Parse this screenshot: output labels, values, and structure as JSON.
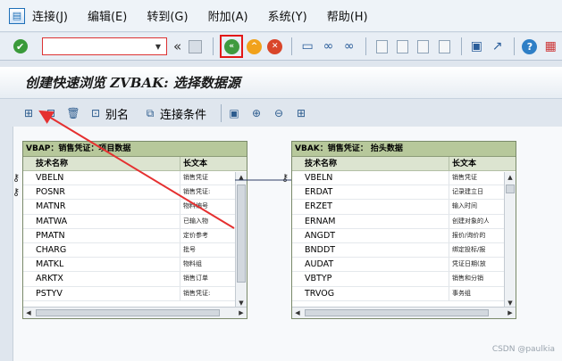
{
  "menu": [
    "连接(J)",
    "编辑(E)",
    "转到(G)",
    "附加(A)",
    "系统(Y)",
    "帮助(H)"
  ],
  "toolbar": {
    "command_value": ""
  },
  "title": "创建快速浏览 ZVBAK: 选择数据源",
  "app_toolbar": {
    "alias_label": "别名",
    "join_label": "连接条件"
  },
  "left_table": {
    "title": "VBAP：销售凭证：项目数据",
    "col_name": "技术名称",
    "col_text": "长文本",
    "rows": [
      {
        "name": "VBELN",
        "text": "销售凭证",
        "key": true
      },
      {
        "name": "POSNR",
        "text": "销售凭证:",
        "key": true
      },
      {
        "name": "MATNR",
        "text": "物料编号",
        "key": false
      },
      {
        "name": "MATWA",
        "text": "已输入物",
        "key": false
      },
      {
        "name": "PMATN",
        "text": "定价参考",
        "key": false
      },
      {
        "name": "CHARG",
        "text": "批号",
        "key": false
      },
      {
        "name": "MATKL",
        "text": "物料组",
        "key": false
      },
      {
        "name": "ARKTX",
        "text": "销售订单",
        "key": false
      },
      {
        "name": "PSTYV",
        "text": "销售凭证:",
        "key": false
      }
    ]
  },
  "right_table": {
    "title": "VBAK：销售凭证： 抬头数据",
    "col_name": "技术名称",
    "col_text": "长文本",
    "rows": [
      {
        "name": "VBELN",
        "text": "销售凭证",
        "key": true
      },
      {
        "name": "ERDAT",
        "text": "记录建立日",
        "key": false
      },
      {
        "name": "ERZET",
        "text": "输入时间",
        "key": false
      },
      {
        "name": "ERNAM",
        "text": "创建对象的人",
        "key": false
      },
      {
        "name": "ANGDT",
        "text": "报价/询价的",
        "key": false
      },
      {
        "name": "BNDDT",
        "text": "绑定投标/报",
        "key": false
      },
      {
        "name": "AUDAT",
        "text": "凭证日期(放",
        "key": false
      },
      {
        "name": "VBTYP",
        "text": "销售和分销",
        "key": false
      },
      {
        "name": "TRVOG",
        "text": "事务组",
        "key": false
      }
    ]
  },
  "watermark": "CSDN @paulkia",
  "colors": {
    "highlight_box": "#e31818",
    "arrow": "#e53030",
    "table_header": "#b7c89b"
  }
}
